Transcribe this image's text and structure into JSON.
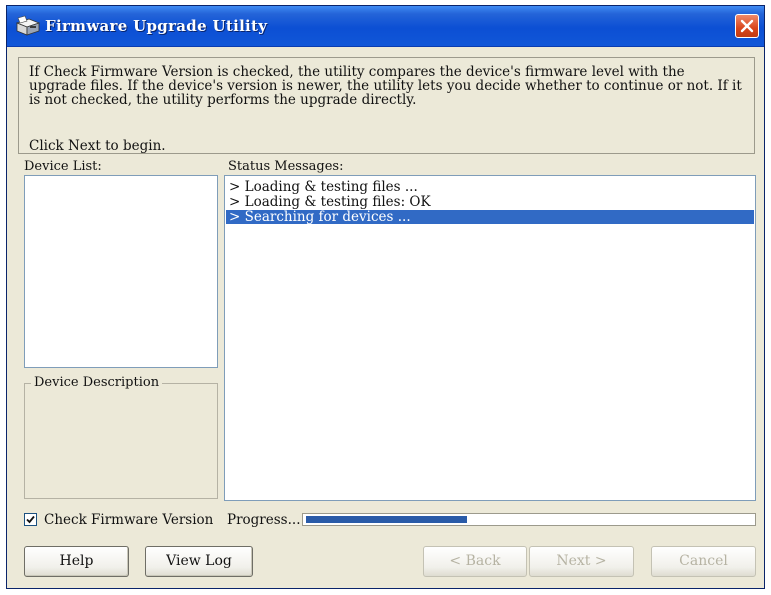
{
  "window": {
    "title": "Firmware Upgrade Utility"
  },
  "info": {
    "description": "If Check Firmware Version is checked, the utility compares the device's firmware level with the upgrade files. If the device's version is newer, the utility lets you decide whether to continue or not. If it is not checked, the utility performs the upgrade directly.",
    "begin": "Click Next to begin."
  },
  "device_list": {
    "label": "Device List:",
    "items": []
  },
  "device_description": {
    "label": "Device Description"
  },
  "status": {
    "label": "Status Messages:",
    "messages": [
      {
        "text": "> Loading & testing files ...",
        "selected": false
      },
      {
        "text": "> Loading & testing files: OK",
        "selected": false
      },
      {
        "text": "> Searching for devices ...",
        "selected": true
      }
    ]
  },
  "options": {
    "check_firmware_label": "Check Firmware Version",
    "check_firmware_checked": true
  },
  "progress": {
    "label": "Progress...",
    "fraction": 0.36
  },
  "buttons": {
    "help": "Help",
    "view_log": "View Log",
    "back": "< Back",
    "next": "Next >",
    "cancel": "Cancel"
  },
  "colors": {
    "titlebar": "#0c4fd4",
    "selection": "#316ac5",
    "progress_fill": "#2a5ba8",
    "close_button": "#d9461c"
  },
  "icons": {
    "app": "software-box-icon",
    "close": "close-icon",
    "check": "checkmark-icon"
  }
}
